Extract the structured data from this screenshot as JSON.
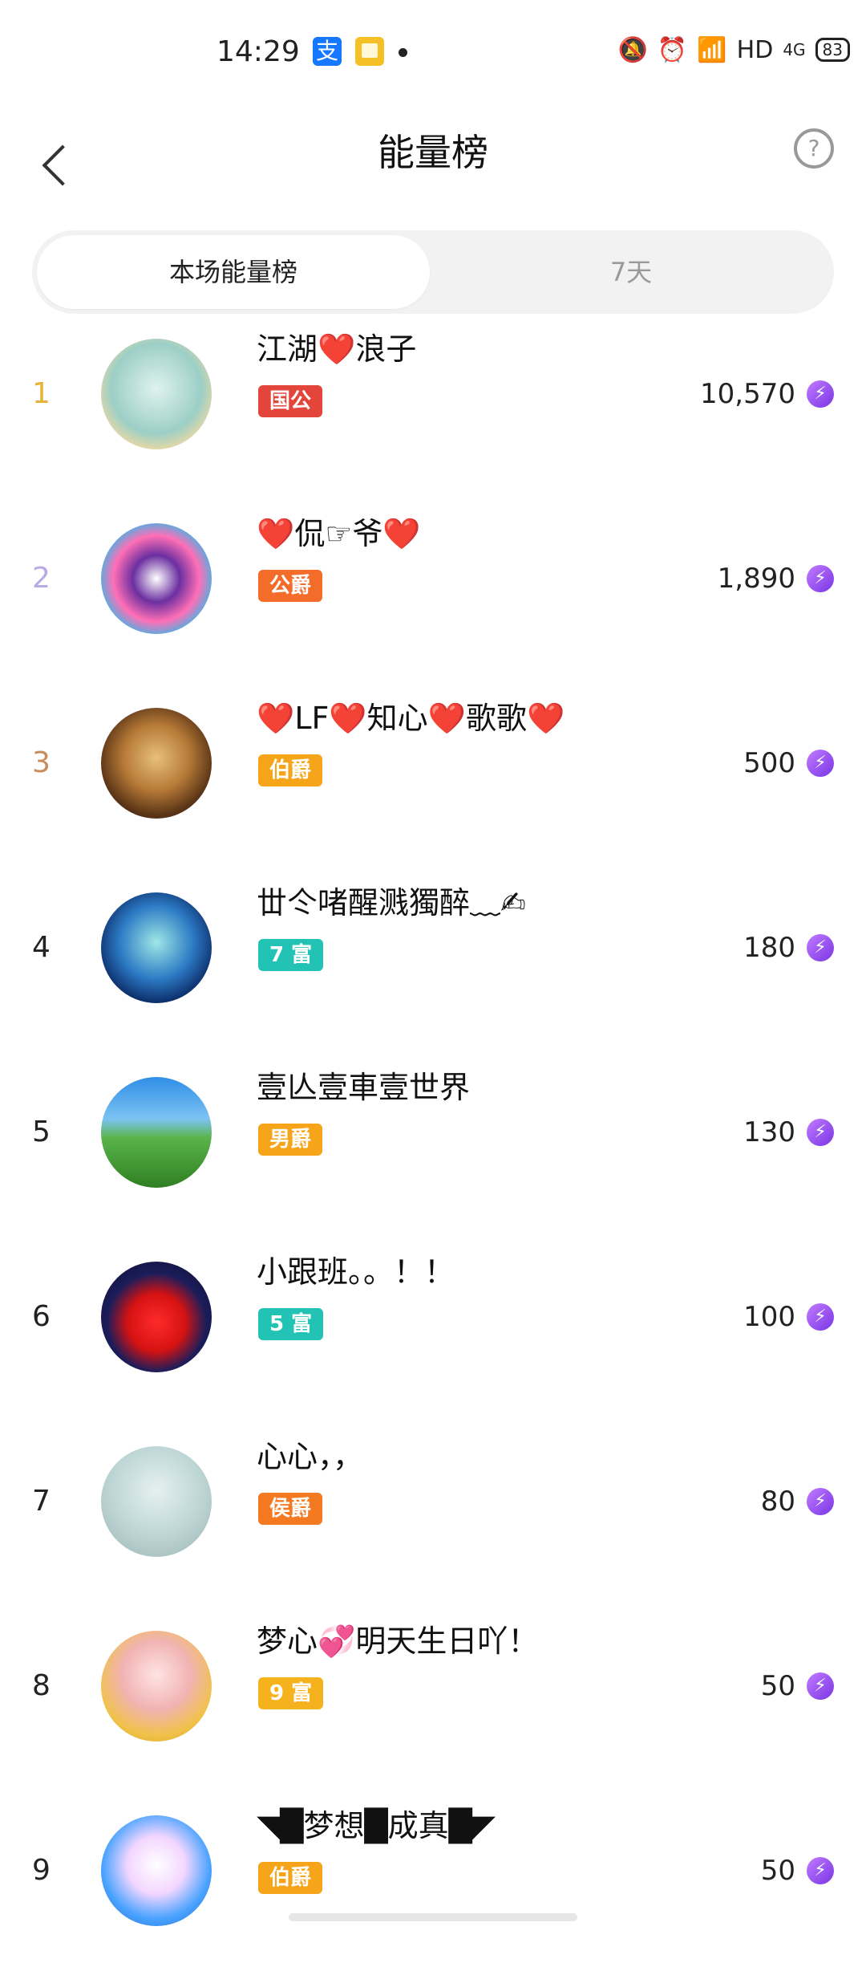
{
  "status_bar": {
    "time": "14:29",
    "alipay_icon_glyph": "支",
    "network": "HD",
    "signal": "4G",
    "battery": "83"
  },
  "header": {
    "title": "能量榜",
    "help_glyph": "?"
  },
  "tabs": [
    {
      "label": "本场能量榜",
      "active": true
    },
    {
      "label": "7天",
      "active": false
    }
  ],
  "leaderboard": [
    {
      "rank": "1",
      "name": "江湖❤️浪子",
      "badge": "国公",
      "score": "10,570"
    },
    {
      "rank": "2",
      "name": "❤️侃☞爷❤️",
      "badge": "公爵",
      "score": "1,890"
    },
    {
      "rank": "3",
      "name": "❤️LF❤️知心❤️歌歌❤️",
      "badge": "伯爵",
      "score": "500"
    },
    {
      "rank": "4",
      "name": "丗仒啫醒溅獨醉﹏✍",
      "badge": "7 富",
      "score": "180"
    },
    {
      "rank": "5",
      "name": "壹亾壹車壹世界",
      "badge": "男爵",
      "score": "130"
    },
    {
      "rank": "6",
      "name": "小跟班。。！！",
      "badge": "5 富",
      "score": "100"
    },
    {
      "rank": "7",
      "name": "心心，，",
      "badge": "侯爵",
      "score": "80"
    },
    {
      "rank": "8",
      "name": "梦心💞明天生日吖！",
      "badge": "9 富",
      "score": "50"
    },
    {
      "rank": "9",
      "name": "◥█梦想█成真█◤",
      "badge": "伯爵",
      "score": "50"
    }
  ],
  "colors": {
    "rank1": "#e8b23a",
    "rank2": "#b9a9e6",
    "rank3": "#c98b5a",
    "rank_default": "#222222",
    "badge_guogong": "#e4453a",
    "badge_gongjue": "#f36c2a",
    "badge_bojue": "#f6a51b",
    "badge_fu": "#22c3b4",
    "badge_nanjue": "#f6a51b",
    "badge_houjue": "#f47a22",
    "badge_fu_gold": "#f6b21d",
    "energy_bolt": "#8a45f0"
  },
  "icons": [
    "back-arrow-icon",
    "help-icon",
    "energy-bolt-icon",
    "alipay-icon",
    "book-icon",
    "mute-icon",
    "alarm-icon",
    "wifi-icon",
    "battery-icon"
  ]
}
